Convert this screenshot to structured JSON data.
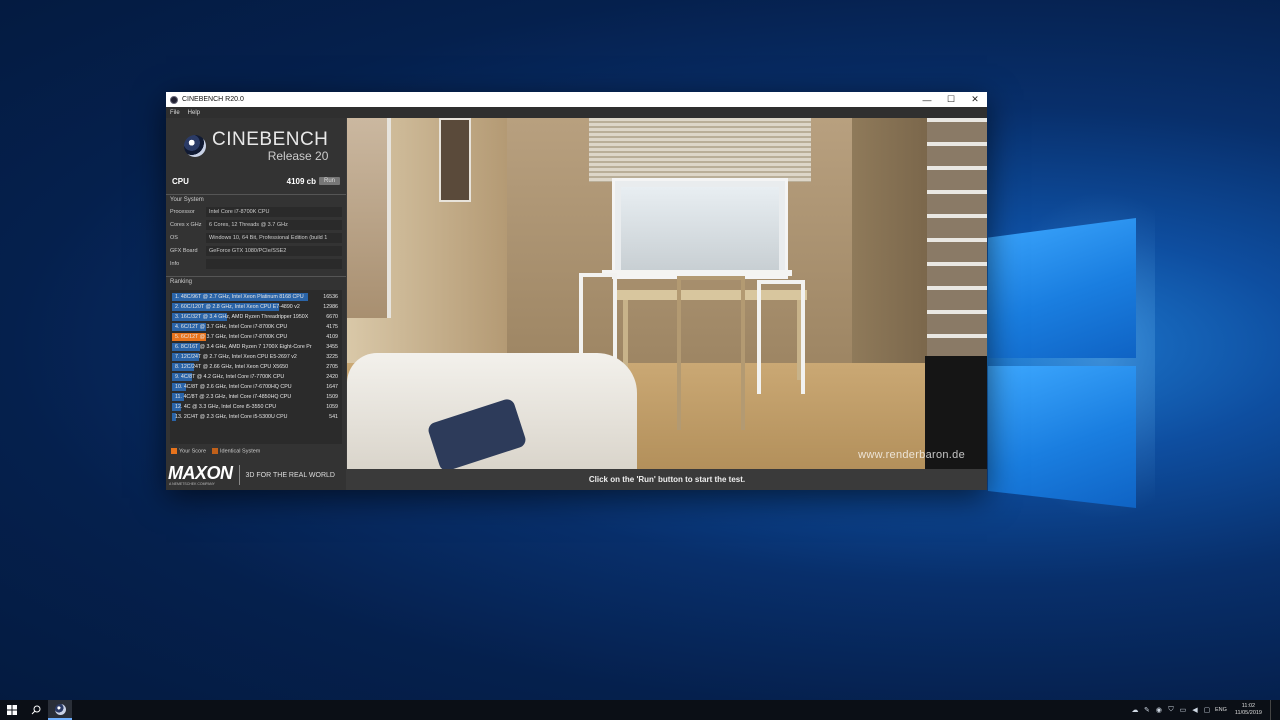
{
  "window": {
    "title": "CINEBENCH R20.0",
    "minimize": "—",
    "maximize": "☐",
    "close": "✕"
  },
  "menu": [
    "File",
    "Help"
  ],
  "brand": {
    "name": "CINEBENCH",
    "release": "Release 20"
  },
  "cpu": {
    "label": "CPU",
    "score": "4109 cb",
    "run_label": "Run"
  },
  "your_system": {
    "title": "Your System",
    "rows": [
      {
        "key": "Processor",
        "value": "Intel Core i7-8700K CPU"
      },
      {
        "key": "Cores x GHz",
        "value": "6 Cores, 12 Threads @ 3.7 GHz"
      },
      {
        "key": "OS",
        "value": "Windows 10, 64 Bit, Professional Edition (build 1"
      },
      {
        "key": "GFX Board",
        "value": "GeForce GTX 1080/PCIe/SSE2"
      },
      {
        "key": "Info",
        "value": ""
      }
    ]
  },
  "ranking": {
    "title": "Ranking",
    "max_score": 16536,
    "rows": [
      {
        "label": "1. 48C/96T @ 2.7 GHz, Intel Xeon Platinum 8168 CPU",
        "score": "16536",
        "value": 16536,
        "mine": false
      },
      {
        "label": "2. 60C/120T @ 2.8 GHz, Intel Xeon CPU E7-4890 v2",
        "score": "12986",
        "value": 12986,
        "mine": false
      },
      {
        "label": "3. 16C/32T @ 3.4 GHz, AMD Ryzen Threadripper 1950X",
        "score": "6670",
        "value": 6670,
        "mine": false
      },
      {
        "label": "4. 6C/12T @ 3.7 GHz, Intel Core i7-8700K CPU",
        "score": "4175",
        "value": 4175,
        "mine": false
      },
      {
        "label": "5. 6C/12T @ 3.7 GHz, Intel Core i7-8700K CPU",
        "score": "4109",
        "value": 4109,
        "mine": true
      },
      {
        "label": "6. 8C/16T @ 3.4 GHz, AMD Ryzen 7 1700X Eight-Core Pr",
        "score": "3455",
        "value": 3455,
        "mine": false
      },
      {
        "label": "7. 12C/24T @ 2.7 GHz, Intel Xeon CPU E5-2697 v2",
        "score": "3225",
        "value": 3225,
        "mine": false
      },
      {
        "label": "8. 12C/24T @ 2.66 GHz, Intel Xeon CPU X5650",
        "score": "2705",
        "value": 2705,
        "mine": false
      },
      {
        "label": "9. 4C/8T @ 4.2 GHz, Intel Core i7-7700K CPU",
        "score": "2420",
        "value": 2420,
        "mine": false
      },
      {
        "label": "10. 4C/8T @ 2.6 GHz, Intel Core i7-6700HQ CPU",
        "score": "1647",
        "value": 1647,
        "mine": false
      },
      {
        "label": "11. 4C/8T @ 2.3 GHz, Intel Core i7-4850HQ CPU",
        "score": "1509",
        "value": 1509,
        "mine": false
      },
      {
        "label": "12. 4C @ 3.3 GHz, Intel Core i5-3550 CPU",
        "score": "1059",
        "value": 1059,
        "mine": false
      },
      {
        "label": "13. 2C/4T @ 2.3 GHz, Intel Core i5-5300U CPU",
        "score": "541",
        "value": 541,
        "mine": false
      }
    ],
    "legend": {
      "your_score": "Your Score",
      "identical": "Identical System"
    }
  },
  "maxon": {
    "logo": "MAXON",
    "sub": "A NEMETSCHEK COMPANY",
    "tagline": "3D FOR THE REAL WORLD"
  },
  "viewport": {
    "watermark": "www.renderbaron.de"
  },
  "status": "Click on the 'Run' button to start the test.",
  "taskbar": {
    "tray_lang": "ENG",
    "time": "11:02",
    "date": "11/05/2019"
  },
  "colors": {
    "bar": "#2a64a8",
    "my_bar": "#e7731c",
    "identical": "#c0601a"
  }
}
